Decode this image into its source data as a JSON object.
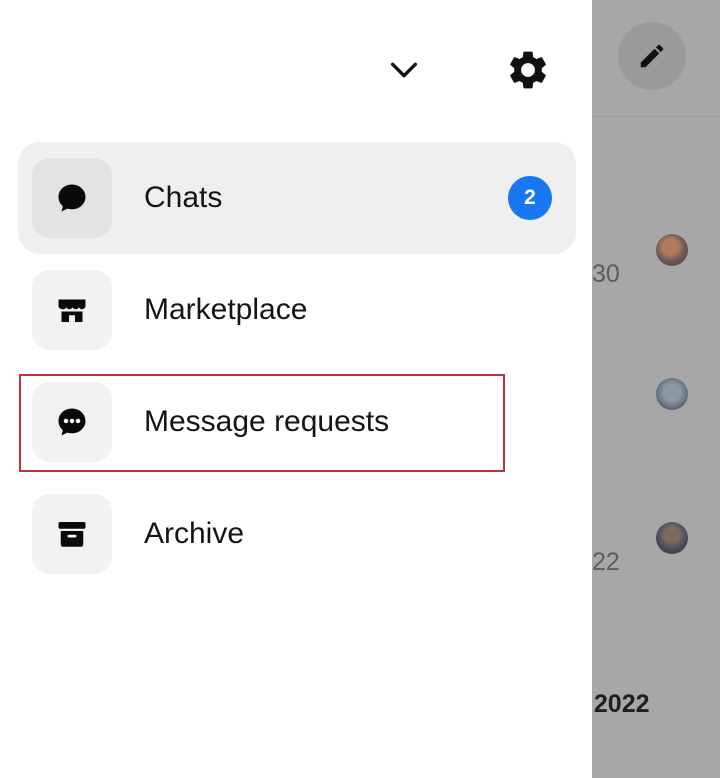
{
  "header": {
    "dropdown_icon": "chevron-down-icon",
    "settings_icon": "gear-icon"
  },
  "menu": {
    "items": [
      {
        "label": "Chats",
        "icon": "chat-bubble-icon",
        "badge": "2",
        "active": true
      },
      {
        "label": "Marketplace",
        "icon": "storefront-icon"
      },
      {
        "label": "Message requests",
        "icon": "message-request-icon",
        "highlighted": true
      },
      {
        "label": "Archive",
        "icon": "archive-box-icon"
      }
    ]
  },
  "background": {
    "compose_icon": "pencil-icon",
    "times": [
      "30",
      "22"
    ],
    "date_fragment": ", 2022"
  },
  "colors": {
    "badge": "#1877f2",
    "highlight": "#c4303b",
    "overlay": "#a7a7a7"
  }
}
